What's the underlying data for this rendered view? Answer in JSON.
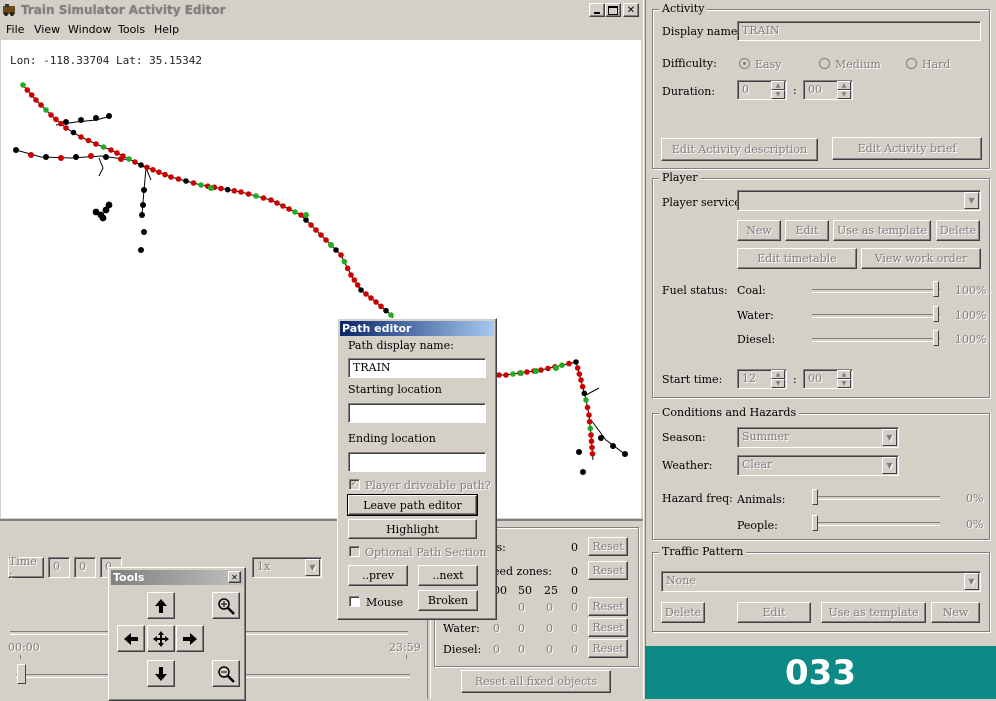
{
  "window": {
    "title": "Train Simulator Activity Editor",
    "menu": [
      "File",
      "View",
      "Window",
      "Tools",
      "Help"
    ],
    "coords": "Lon: -118.33704 Lat: 35.15342"
  },
  "map": {
    "track_color": "#000000",
    "node_red": "#cc0000",
    "node_green": "#22aa22"
  },
  "time_bar": {
    "time_label": "Time :",
    "fields": [
      "0",
      "0",
      "0"
    ],
    "multiplier": "1x",
    "start": "00:00",
    "end": "23:59"
  },
  "tools": {
    "title": "Tools",
    "close": "✕"
  },
  "path_editor": {
    "title": "Path editor",
    "display_name_label": "Path display name:",
    "display_name_value": "TRAIN",
    "start_label": "Starting location",
    "start_value": "",
    "end_label": "Ending location",
    "end_value": "",
    "drivable_label": "Player driveable path?",
    "leave_button": "Leave path editor",
    "highlight_button": "Highlight",
    "optional_label": "Optional Path Section",
    "prev_button": "..prev",
    "next_button": "..next",
    "mouse_label": "Mouse",
    "broken_button": "Broken"
  },
  "objects_panel": {
    "labels_frag": "ls:",
    "speed_frag": "eed zones:",
    "row1_value": "0",
    "row2_value": "0",
    "speed_values": [
      "00",
      "50",
      "25",
      "0"
    ],
    "row4_values": [
      "0",
      "0",
      "0"
    ],
    "water_label": "Water:",
    "water_values": [
      "0",
      "0",
      "0",
      "0"
    ],
    "diesel_label": "Diesel:",
    "diesel_values": [
      "0",
      "0",
      "0",
      "0"
    ],
    "reset": "Reset",
    "reset_all": "Reset all fixed objects"
  },
  "activity": {
    "title": "Activity",
    "display_name_label": "Display name:",
    "display_name_value": "TRAIN",
    "difficulty_label": "Difficulty:",
    "easy": "Easy",
    "medium": "Medium",
    "hard": "Hard",
    "duration_label": "Duration:",
    "duration_h": "0",
    "duration_m": "00",
    "edit_description": "Edit Activity description",
    "edit_brief": "Edit Activity brief"
  },
  "player": {
    "title": "Player",
    "service_label": "Player service:",
    "new": "New",
    "edit": "Edit",
    "template": "Use as template",
    "delete": "Delete",
    "edit_timetable": "Edit timetable",
    "view_work_order": "View work order",
    "fuel_label": "Fuel status:",
    "coal_label": "Coal:",
    "coal_value": "100%",
    "coal_level": 1.0,
    "water_label": "Water:",
    "water_value": "100%",
    "water_level": 1.0,
    "diesel_label": "Diesel:",
    "diesel_value": "100%",
    "diesel_level": 1.0,
    "start_label": "Start time:",
    "start_h": "12",
    "start_m": "00"
  },
  "conditions": {
    "title": "Conditions and Hazards",
    "season_label": "Season:",
    "season_value": "Summer",
    "weather_label": "Weather:",
    "weather_value": "Clear",
    "hazard_label": "Hazard freq:",
    "animals_label": "Animals:",
    "animals_value": "0%",
    "people_label": "People:",
    "people_value": "0%"
  },
  "traffic": {
    "title": "Traffic Pattern",
    "value": "None",
    "delete": "Delete",
    "edit": "Edit",
    "template": "Use as template",
    "new": "New"
  },
  "badge": {
    "number": "033",
    "color": "#0e8a86"
  }
}
